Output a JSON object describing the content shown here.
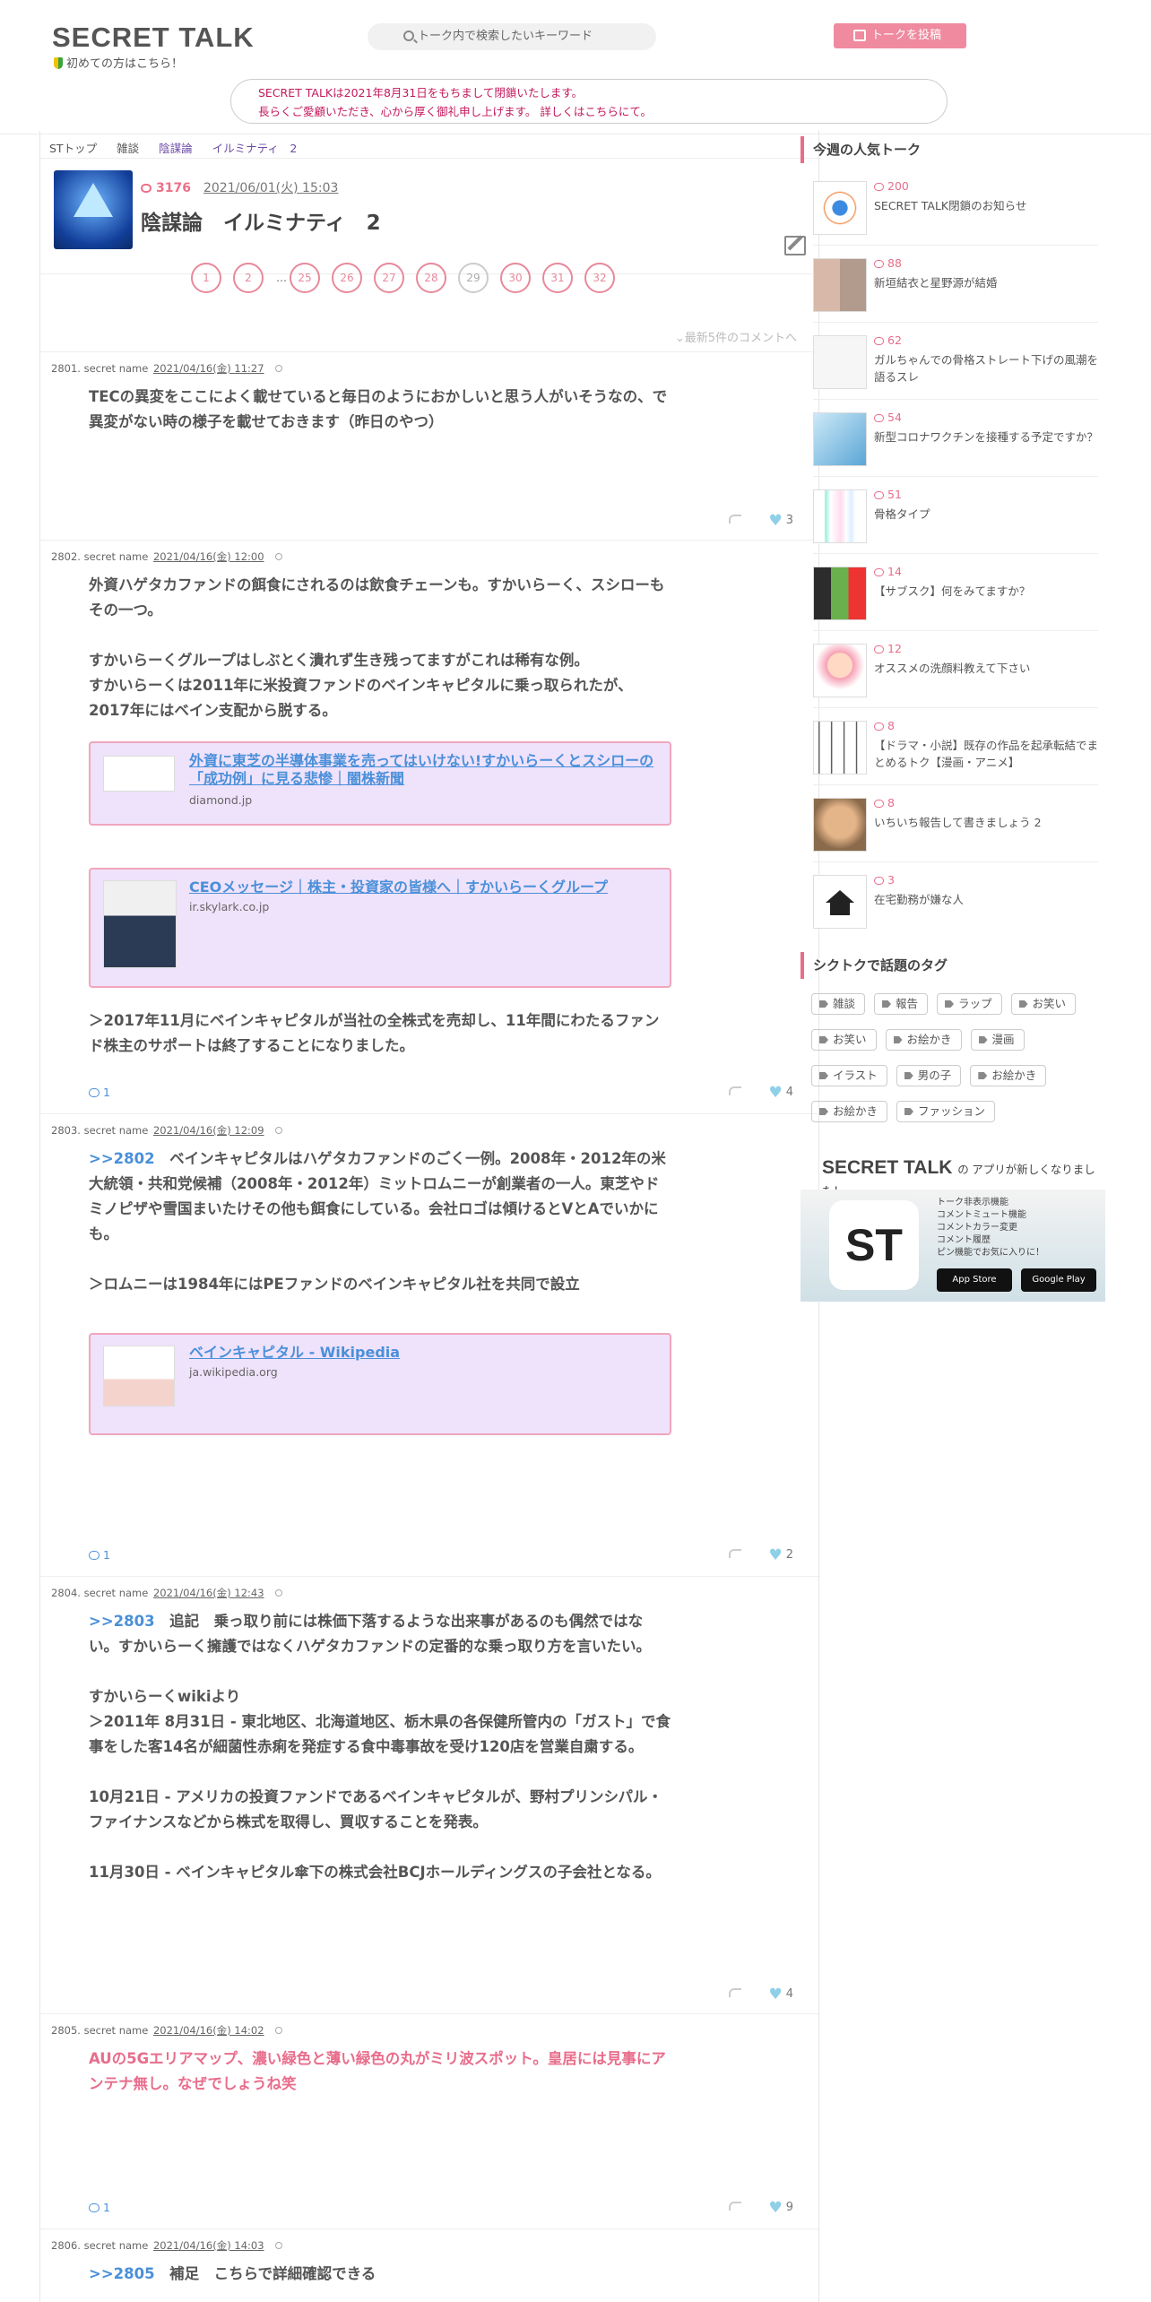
{
  "header": {
    "logo": "SECRET TALK",
    "beginner": "初めての方はこちら！",
    "search_placeholder": "トーク内で検索したいキーワード",
    "post_button": "トークを投稿"
  },
  "notice": {
    "line1": "SECRET TALKは2021年8月31日をもちまして閉鎖いたします。",
    "line2": "長らくご愛顧いただき、心から厚く御礼申し上げます。 詳しくはこちらにて。"
  },
  "breadcrumb": [
    "STトップ",
    "雑談",
    "陰謀論",
    "イルミナティ　2"
  ],
  "topic": {
    "count": "3176",
    "date": "2021/06/01(火) 15:03",
    "title": "陰謀論　イルミナティ　2"
  },
  "pager": [
    "1",
    "2",
    "…",
    "25",
    "26",
    "27",
    "28",
    "29",
    "30",
    "31",
    "32"
  ],
  "latest_link": "最新5件のコメントへ",
  "comments": [
    {
      "num": "2801.",
      "name": "secret name",
      "date": "2021/04/16(金) 11:27",
      "body": "TECの異変をここによく載せていると毎日のようにおかしいと思う人がいそうなの、で異変がない時の様子を載せておきます（昨日のやつ）",
      "likes": "3"
    },
    {
      "num": "2802.",
      "name": "secret name",
      "date": "2021/04/16(金) 12:00",
      "body": "外資ハゲタカファンドの餌食にされるのは飲食チェーンも。すかいらーく、スシローもその一つ。\n\nすかいらーくグループはしぶとく潰れず生き残ってますがこれは稀有な例。\nすかいらーくは2011年に米投資ファンドのベインキャピタルに乗っ取られたが、2017年にはベイン支配から脱する。",
      "link1_title": "外資に東芝の半導体事業を売ってはいけない!すかいらーくとスシローの「成功例」に見る悲惨｜闇株新聞",
      "link1_domain": "diamond.jp",
      "link2_title": "CEOメッセージ｜株主・投資家の皆様へ｜すかいらーくグループ",
      "link2_domain": "ir.skylark.co.jp",
      "body2": "＞2017年11月にベインキャピタルが当社の全株式を売却し、11年間にわたるファンド株主のサポートは終了することになりました。",
      "replies": "1",
      "likes": "4"
    },
    {
      "num": "2803.",
      "name": "secret name",
      "date": "2021/04/16(金) 12:09",
      "anchor": ">>2802",
      "body": "　ベインキャピタルはハゲタカファンドのごく一例。2008年・2012年の米大統領・共和党候補（2008年・2012年）ミットロムニーが創業者の一人。東芝やドミノピザや雪国まいたけその他も餌食にしている。会社ロゴは傾けるとVとAでいかにも。\n\n＞ロムニーは1984年にはPEファンドのベインキャピタル社を共同で設立",
      "link_title": "ベインキャピタル - Wikipedia",
      "link_domain": "ja.wikipedia.org",
      "replies": "1",
      "likes": "2"
    },
    {
      "num": "2804.",
      "name": "secret name",
      "date": "2021/04/16(金) 12:43",
      "anchor": ">>2803",
      "body": "　追記　乗っ取り前には株価下落するような出来事があるのも偶然ではない。すかいらーく擁護ではなくハゲタカファンドの定番的な乗っ取り方を言いたい。\n\nすかいらーくwikiより\n＞2011年 8月31日 - 東北地区、北海道地区、栃木県の各保健所管内の「ガスト」で食事をした客14名が細菌性赤痢を発症する食中毒事故を受け120店を営業自粛する。\n\n10月21日 - アメリカの投資ファンドであるベインキャピタルが、野村プリンシパル・ファイナンスなどから株式を取得し、買収することを発表。\n\n11月30日 - ベインキャピタル傘下の株式会社BCJホールディングスの子会社となる。",
      "likes": "4"
    },
    {
      "num": "2805.",
      "name": "secret name",
      "date": "2021/04/16(金) 14:02",
      "body": "AUの5Gエリアマップ、濃い緑色と薄い緑色の丸がミリ波スポット。皇居には見事にアンテナ無し。なぜでしょうね笑",
      "replies": "1",
      "likes": "9"
    },
    {
      "num": "2806.",
      "name": "secret name",
      "date": "2021/04/16(金) 14:03",
      "anchor": ">>2805",
      "body": "　補足　こちらで詳細確認できる"
    }
  ],
  "sidebar": {
    "popular_title": "今週の人気トーク",
    "topics": [
      {
        "count": "200",
        "title": "SECRET TALK閉鎖のお知らせ"
      },
      {
        "count": "88",
        "title": "新垣結衣と星野源が結婚"
      },
      {
        "count": "62",
        "title": "ガルちゃんでの骨格ストレート下げの風潮を語るスレ"
      },
      {
        "count": "54",
        "title": "新型コロナワクチンを接種する予定ですか？"
      },
      {
        "count": "51",
        "title": "骨格タイプ"
      },
      {
        "count": "14",
        "title": "【サブスク】何をみてますか？"
      },
      {
        "count": "12",
        "title": "オススメの洗顔料教えて下さい"
      },
      {
        "count": "8",
        "title": "【ドラマ・小説】既存の作品を起承転結でまとめるトク【漫画・アニメ】"
      },
      {
        "count": "8",
        "title": "いちいち報告して書きましょう 2"
      },
      {
        "count": "3",
        "title": "在宅勤務が嫌な人"
      }
    ],
    "tags_title": "シクトクで話題のタグ",
    "tags": [
      "雑談",
      "報告",
      "ラップ",
      "お笑い",
      "お笑い",
      "お絵かき",
      "漫画",
      "イラスト",
      "男の子",
      "お絵かき",
      "お絵かき",
      "ファッション"
    ],
    "app": {
      "title": "SECRET TALK",
      "subtitle": "の アプリが新しくなりました！",
      "icon": "ST",
      "features": "トーク非表示機能\nコメントミュート機能\nコメントカラー変更\nコメント履歴\nピン機能でお気に入りに！",
      "appstore": "App Store",
      "googleplay": "Google Play"
    }
  }
}
